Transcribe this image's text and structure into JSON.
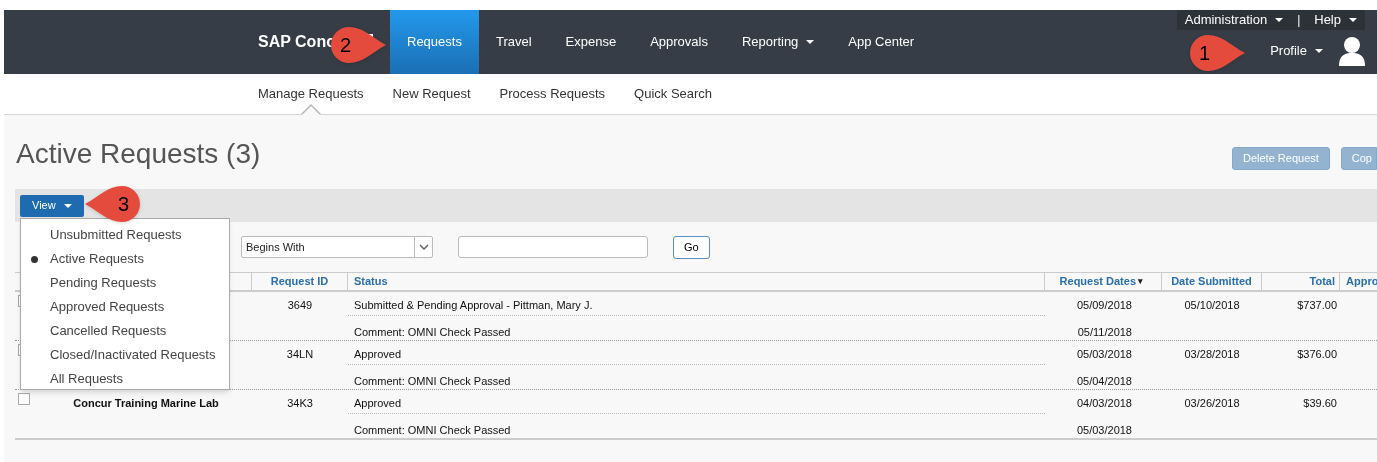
{
  "header": {
    "logo": "SAP Conc",
    "nav": [
      {
        "label": "Requests",
        "selected": true,
        "dropdown": false
      },
      {
        "label": "Travel",
        "selected": false,
        "dropdown": false
      },
      {
        "label": "Expense",
        "selected": false,
        "dropdown": false
      },
      {
        "label": "Approvals",
        "selected": false,
        "dropdown": false
      },
      {
        "label": "Reporting",
        "selected": false,
        "dropdown": true
      },
      {
        "label": "App Center",
        "selected": false,
        "dropdown": false
      }
    ],
    "utility": [
      {
        "label": "Administration",
        "dropdown": true
      },
      {
        "label": "Help",
        "dropdown": true
      }
    ],
    "separator": "|",
    "profile": {
      "label": "Profile",
      "dropdown": true
    }
  },
  "subnav": [
    {
      "label": "Manage Requests",
      "selected": true
    },
    {
      "label": "New Request",
      "selected": false
    },
    {
      "label": "Process Requests",
      "selected": false
    },
    {
      "label": "Quick Search",
      "selected": false
    }
  ],
  "page": {
    "title": "Active Requests (3)",
    "actions": [
      {
        "label": "Delete Request",
        "disabled": true
      },
      {
        "label": "Cop",
        "disabled": true
      }
    ]
  },
  "toolbar": {
    "view_button": "View"
  },
  "view_menu": [
    {
      "label": "Unsubmitted Requests",
      "selected": false
    },
    {
      "label": "Active Requests",
      "selected": true
    },
    {
      "label": "Pending Requests",
      "selected": false
    },
    {
      "label": "Approved Requests",
      "selected": false
    },
    {
      "label": "Cancelled Requests",
      "selected": false
    },
    {
      "label": "Closed/Inactivated Requests",
      "selected": false
    },
    {
      "label": "All Requests",
      "selected": false
    }
  ],
  "filter": {
    "operator": "Begins With",
    "go": "Go"
  },
  "table": {
    "columns": [
      {
        "label": "Request ID"
      },
      {
        "label": "Status"
      },
      {
        "label": "Request Dates",
        "sort_indicator": "▾"
      },
      {
        "label": "Date Submitted"
      },
      {
        "label": "Total"
      },
      {
        "label": "Appro"
      }
    ],
    "rows": [
      {
        "checked": false,
        "id": "3649",
        "status": "Submitted & Pending Approval - Pittman, Mary J.",
        "comment": "Comment: OMNI Check Passed",
        "start_date": "05/09/2018",
        "end_date": "05/11/2018",
        "submitted": "05/10/2018",
        "total": "$737.00"
      },
      {
        "checked": false,
        "id": "34LN",
        "status": "Approved",
        "comment": "Comment: OMNI Check Passed",
        "start_date": "05/03/2018",
        "end_date": "05/04/2018",
        "submitted": "03/28/2018",
        "total": "$376.00"
      },
      {
        "checked": false,
        "name": "Concur Training Marine Lab",
        "id": "34K3",
        "status": "Approved",
        "comment": "Comment: OMNI Check Passed",
        "start_date": "04/03/2018",
        "end_date": "05/03/2018",
        "submitted": "03/26/2018",
        "total": "$39.60"
      }
    ]
  },
  "callouts": [
    {
      "number": "1",
      "kind": "right"
    },
    {
      "number": "2",
      "kind": "right"
    },
    {
      "number": "3",
      "kind": "left"
    }
  ]
}
